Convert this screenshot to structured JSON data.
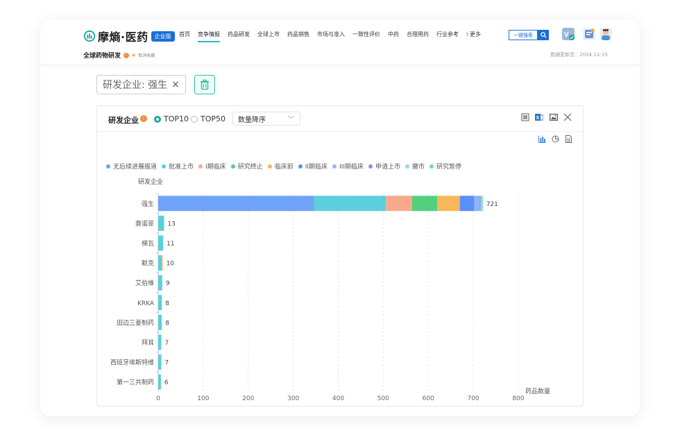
{
  "brand": {
    "name": "摩熵·医药",
    "badge": "企业版"
  },
  "nav": {
    "items": [
      {
        "label": "首页",
        "active": false
      },
      {
        "label": "竞争情报",
        "active": true
      },
      {
        "label": "药品研发",
        "active": false
      },
      {
        "label": "全球上市",
        "active": false
      },
      {
        "label": "药品销售",
        "active": false
      },
      {
        "label": "市场与准入",
        "active": false
      },
      {
        "label": "一致性评价",
        "active": false
      },
      {
        "label": "中药",
        "active": false
      },
      {
        "label": "合理用药",
        "active": false
      },
      {
        "label": "行业参考",
        "active": false
      }
    ],
    "more_label": "更多",
    "search_label": "一键搜索"
  },
  "subheader": {
    "title": "全球药物研发",
    "info": "!",
    "star": "★",
    "unfavorite": "取消收藏",
    "update_text": "数据更新至：2024-11-15"
  },
  "filter": {
    "chip_text": "研发企业: 强生",
    "chip_close": "×"
  },
  "panel": {
    "title": "研发企业",
    "info": "!",
    "options": [
      {
        "label": "TOP10",
        "selected": true
      },
      {
        "label": "TOP50",
        "selected": false
      }
    ],
    "sort_value": "数量降序",
    "sort_arrow": "﹀",
    "close": "✕"
  },
  "chart_data": {
    "type": "bar",
    "orientation": "horizontal",
    "stacked": true,
    "ylabel": "研发企业",
    "xlabel": "药品数量",
    "xlim": [
      0,
      800
    ],
    "xticks": [
      0,
      100,
      200,
      300,
      400,
      500,
      600,
      700,
      800
    ],
    "grid": true,
    "legend_position": "top-left",
    "categories": [
      "强生",
      "赛诺菲",
      "梯瓦",
      "默克",
      "艾伯维",
      "KRKA",
      "田边三菱制药",
      "拜耳",
      "西班牙埃斯特维",
      "第一三共制药"
    ],
    "totals": [
      721,
      13,
      11,
      10,
      9,
      8,
      8,
      7,
      7,
      6
    ],
    "series": [
      {
        "name": "无后续进展报道",
        "color": "#6fa3f7",
        "values": [
          346,
          0,
          0,
          0,
          0,
          0,
          0,
          0,
          0,
          0
        ]
      },
      {
        "name": "批准上市",
        "color": "#5bcfde",
        "values": [
          160,
          13,
          11,
          8,
          9,
          8,
          8,
          7,
          7,
          6
        ]
      },
      {
        "name": "I期临床",
        "color": "#f8a98c",
        "values": [
          58,
          0,
          0,
          0,
          0,
          0,
          0,
          0,
          0,
          0
        ]
      },
      {
        "name": "研究终止",
        "color": "#52d07e",
        "values": [
          56,
          0,
          0,
          0,
          0,
          0,
          0,
          0,
          0,
          0
        ]
      },
      {
        "name": "临床前",
        "color": "#f7b75a",
        "values": [
          50,
          0,
          0,
          2,
          0,
          0,
          0,
          0,
          0,
          0
        ]
      },
      {
        "name": "II期临床",
        "color": "#5b8ff9",
        "values": [
          32,
          0,
          0,
          0,
          0,
          0,
          0,
          0,
          0,
          0
        ]
      },
      {
        "name": "III期临床",
        "color": "#8fb4f9",
        "values": [
          12,
          0,
          0,
          0,
          0,
          0,
          0,
          0,
          0,
          0
        ]
      },
      {
        "name": "申请上市",
        "color": "#8e8fe6",
        "values": [
          2,
          0,
          0,
          0,
          0,
          0,
          0,
          0,
          0,
          0
        ]
      },
      {
        "name": "撤市",
        "color": "#9ad6ef",
        "values": [
          3,
          0,
          0,
          0,
          0,
          0,
          0,
          0,
          0,
          0
        ]
      },
      {
        "name": "研究暂停",
        "color": "#6fdca6",
        "values": [
          2,
          0,
          0,
          0,
          0,
          0,
          0,
          0,
          0,
          0
        ]
      }
    ]
  }
}
